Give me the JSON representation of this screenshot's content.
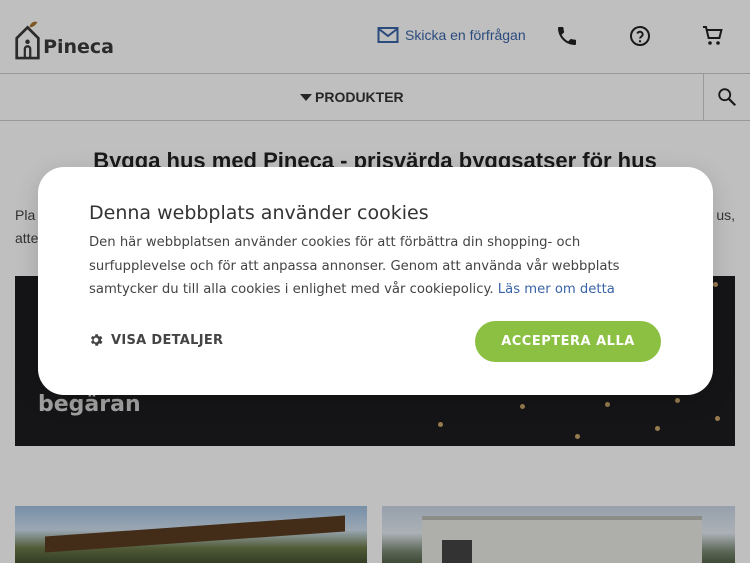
{
  "header": {
    "brand": "Pineca",
    "request_label": "Skicka en förfrågan"
  },
  "nav": {
    "products_label": "PRODUKTER"
  },
  "main": {
    "title": "Bygga hus med Pineca - prisvärda byggsatser för hus",
    "intro_left_1": "Pla",
    "intro_right_1": "us,",
    "intro_left_2": "atte",
    "banner_text": "begäran"
  },
  "cookie": {
    "title": "Denna webbplats använder cookies",
    "body": "Den här webbplatsen använder cookies för att förbättra din shopping- och surfupplevelse och för att anpassa annonser. Genom att använda vår webbplats samtycker du till alla cookies i enlighet med vår cookiepolicy.",
    "link": "Läs mer om detta",
    "details_label": "VISA DETALJER",
    "accept_label": "ACCEPTERA ALLA"
  },
  "colors": {
    "accent_green": "#8bc043",
    "link_blue": "#3a64a8"
  },
  "icons": [
    "house-logo-icon",
    "mail-icon",
    "phone-icon",
    "help-icon",
    "cart-icon",
    "caret-down-icon",
    "search-icon",
    "gear-icon"
  ]
}
